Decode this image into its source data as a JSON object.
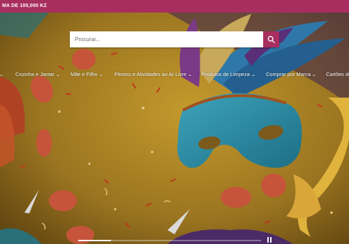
{
  "topbar": {
    "text": "MA DE 100,000 KZ"
  },
  "search": {
    "placeholder": "Procurar...",
    "icon": "search-icon"
  },
  "nav": {
    "items": [
      {
        "label": "Cozinha e Jantar"
      },
      {
        "label": "Mãe e Filho"
      },
      {
        "label": "Fitness e Atividades ao Ar Livre"
      },
      {
        "label": "Produtos de Limpeza"
      },
      {
        "label": "Comprar por Marca"
      },
      {
        "label": "Cartões de"
      }
    ]
  },
  "carousel": {
    "progress": 0.18,
    "control_icon": "pause-icon"
  },
  "colors": {
    "accent": "#a82e5f",
    "background": "#8a6a18"
  }
}
